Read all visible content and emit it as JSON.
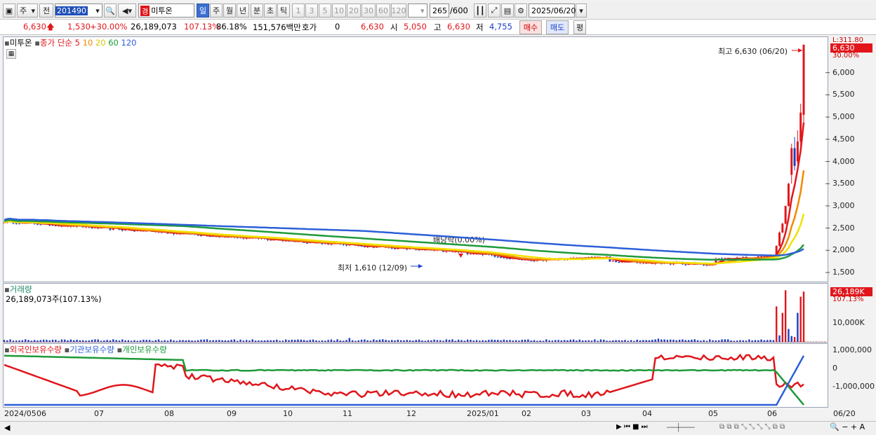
{
  "toolbar": {
    "period_label": "주",
    "prev_label": "전",
    "code": "201490",
    "stock_name": "미투온",
    "badge": "경",
    "tf_day": "일",
    "tf_week": "주",
    "tf_month": "월",
    "tf_year": "년",
    "tf_min": "분",
    "tf_sec": "초",
    "tf_tick": "틱",
    "n1": "1",
    "n3": "3",
    "n5": "5",
    "n10": "10",
    "n20": "20",
    "n30": "30",
    "n60": "60",
    "n120": "120",
    "count": "265",
    "count_total": "/600",
    "date": "2025/06/20"
  },
  "quote": {
    "price": "6,630",
    "change": "1,530",
    "change_pct": "+30.00%",
    "volume": "26,189,073",
    "vol_ratio": "107.13%",
    "turnover": "86.18%",
    "amount": "151,576백만",
    "hoga_label": "호가",
    "hoga_val": "0",
    "hoga_price": "6,630",
    "open_label": "시",
    "open": "5,050",
    "high_label": "고",
    "high": "6,630",
    "low_label": "저",
    "low": "4,755",
    "buy_label": "매수",
    "sell_label": "매도",
    "avg_label": "평"
  },
  "price_panel": {
    "name": "미투온",
    "ma_label": "종가 단순",
    "ma5": "5",
    "ma10": "10",
    "ma20": "20",
    "ma60": "60",
    "ma120": "120",
    "limit_label": "L:311.80",
    "last_price": "6,630",
    "last_pct": "30.00%",
    "high_note": "최고 6,630 (06/20)",
    "low_note": "최저 1,610 (12/09)",
    "dividend_note": "배당락(0.00%)",
    "yticks": [
      "6,000",
      "5,500",
      "5,000",
      "4,500",
      "4,000",
      "3,500",
      "3,000",
      "2,500",
      "2,000",
      "1,500"
    ]
  },
  "volume_panel": {
    "title": "거래량",
    "value": "26,189,073주(107.13%)",
    "last": "26,189K",
    "last_pct": "107.13%",
    "yticks": [
      "10,000K"
    ]
  },
  "holdings_panel": {
    "foreign": "외국인보유수량",
    "inst": "기관보유수량",
    "indiv": "개인보유수량",
    "yticks": [
      "1,000,000",
      "0",
      "-1,000,000"
    ]
  },
  "xaxis": [
    "2024/05",
    "06",
    "07",
    "08",
    "09",
    "10",
    "11",
    "12",
    "2025/01",
    "02",
    "03",
    "04",
    "05",
    "06",
    "06/20"
  ],
  "colors": {
    "up": "#e0161b",
    "down": "#1a3fc8",
    "ma5": "#e0161b",
    "ma10": "#f08a00",
    "ma20": "#f2e100",
    "ma60": "#1e9a3a",
    "ma120": "#2c5fd8"
  },
  "chart_data": {
    "type": "line",
    "title": "",
    "price_range": [
      1400,
      6900
    ],
    "low": {
      "date": "12/09",
      "value": 1610
    },
    "high": {
      "date": "06/20",
      "value": 6630
    },
    "close": 6630,
    "recent_ohlc": [
      {
        "o": 3700,
        "h": 4400,
        "l": 3500,
        "c": 4300
      },
      {
        "o": 4300,
        "h": 4550,
        "l": 3800,
        "c": 3900
      },
      {
        "o": 4000,
        "h": 4700,
        "l": 3900,
        "c": 4450
      },
      {
        "o": 4450,
        "h": 5300,
        "l": 4300,
        "c": 5100
      },
      {
        "o": 5050,
        "h": 6630,
        "l": 4755,
        "c": 6630
      }
    ]
  }
}
